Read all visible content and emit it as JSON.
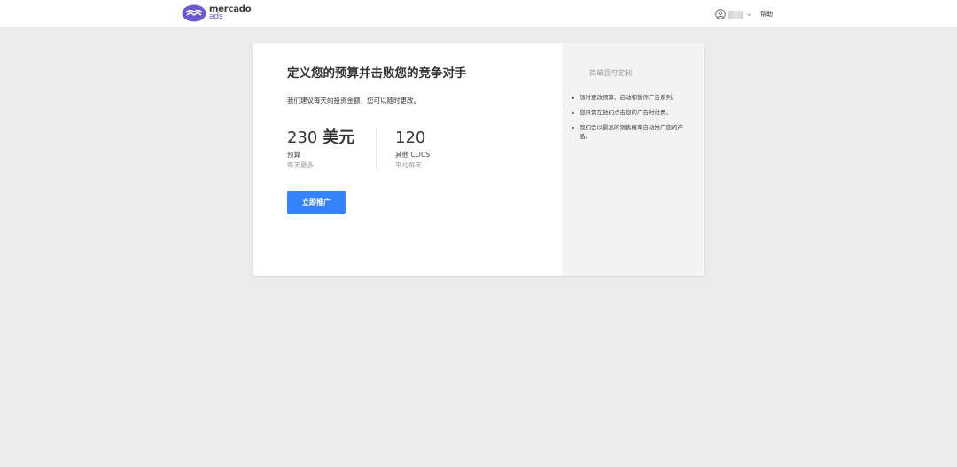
{
  "header": {
    "logo_line1": "mercado",
    "logo_line2": "ads",
    "help_label": "帮助"
  },
  "card": {
    "title": "定义您的预算并击败您的竞争对手",
    "subtitle": "我们建议每天的投资金额，您可以随时更改。",
    "budget": {
      "value": "230",
      "unit": "美元",
      "label": "预算",
      "sub": "每天最多"
    },
    "clics": {
      "value": "120",
      "label": "其他 CLICS",
      "sub": "平均每天"
    },
    "button_label": "立即推广"
  },
  "sidebar": {
    "title": "简单且可定制",
    "items": [
      {
        "text": "随时更改预算、启动和暂停广告系列。"
      },
      {
        "text": "您只需在他们点击您的广告时付费。"
      },
      {
        "text": "我们会以最高的销售概率自动推广您的产品。"
      }
    ]
  },
  "colors": {
    "accent": "#3483fa",
    "brand": "#6a5acd",
    "background": "#ebebeb"
  }
}
